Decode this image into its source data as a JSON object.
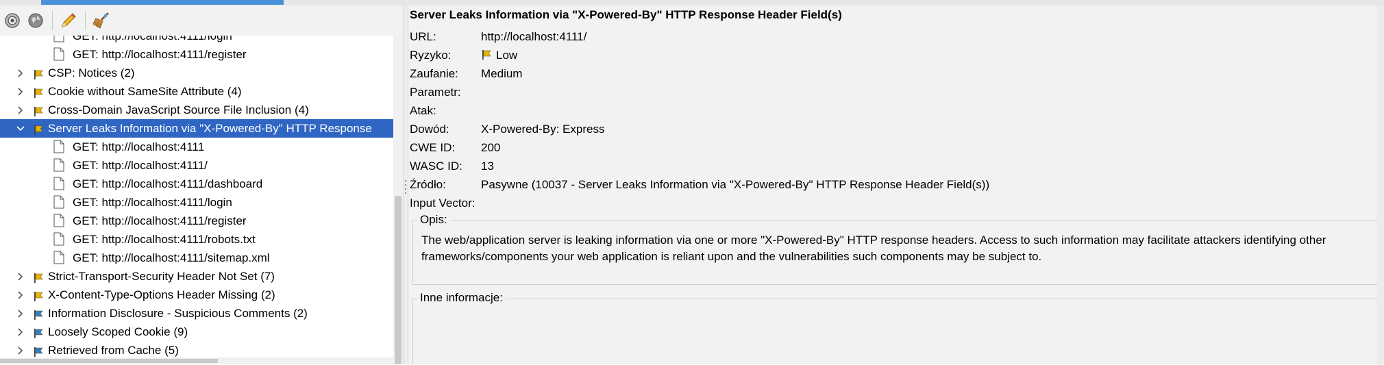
{
  "toolbar": {
    "buttons": [
      {
        "icon": "target-icon"
      },
      {
        "icon": "globe-icon"
      },
      {
        "icon": "pencil-icon"
      },
      {
        "icon": "broom-icon"
      }
    ]
  },
  "tree": {
    "rows": [
      {
        "kind": "url",
        "label": "GET: http://localhost:4111/login"
      },
      {
        "kind": "url",
        "label": "GET: http://localhost:4111/register"
      },
      {
        "kind": "alert",
        "risk": "low",
        "expanded": false,
        "label": "CSP: Notices (2)"
      },
      {
        "kind": "alert",
        "risk": "low",
        "expanded": false,
        "label": "Cookie without SameSite Attribute (4)"
      },
      {
        "kind": "alert",
        "risk": "low",
        "expanded": false,
        "label": "Cross-Domain JavaScript Source File Inclusion (4)"
      },
      {
        "kind": "alert",
        "risk": "low",
        "expanded": true,
        "selected": true,
        "label": "Server Leaks Information via \"X-Powered-By\" HTTP Response"
      },
      {
        "kind": "url",
        "label": "GET: http://localhost:4111"
      },
      {
        "kind": "url",
        "label": "GET: http://localhost:4111/"
      },
      {
        "kind": "url",
        "label": "GET: http://localhost:4111/dashboard"
      },
      {
        "kind": "url",
        "label": "GET: http://localhost:4111/login"
      },
      {
        "kind": "url",
        "label": "GET: http://localhost:4111/register"
      },
      {
        "kind": "url",
        "label": "GET: http://localhost:4111/robots.txt"
      },
      {
        "kind": "url",
        "label": "GET: http://localhost:4111/sitemap.xml"
      },
      {
        "kind": "alert",
        "risk": "low",
        "expanded": false,
        "label": "Strict-Transport-Security Header Not Set (7)"
      },
      {
        "kind": "alert",
        "risk": "low",
        "expanded": false,
        "label": "X-Content-Type-Options Header Missing (2)"
      },
      {
        "kind": "alert",
        "risk": "info",
        "expanded": false,
        "label": "Information Disclosure - Suspicious Comments (2)"
      },
      {
        "kind": "alert",
        "risk": "info",
        "expanded": false,
        "label": "Loosely Scoped Cookie (9)"
      },
      {
        "kind": "alert",
        "risk": "info",
        "expanded": false,
        "label": "Retrieved from Cache (5)"
      }
    ]
  },
  "details": {
    "title": "Server Leaks Information via \"X-Powered-By\" HTTP Response Header Field(s)",
    "fields": [
      {
        "key": "URL:",
        "value": "http://localhost:4111/"
      },
      {
        "key": "Ryzyko:",
        "value": "Low",
        "flag": true
      },
      {
        "key": "Zaufanie:",
        "value": "Medium"
      },
      {
        "key": "Parametr:",
        "value": ""
      },
      {
        "key": "Atak:",
        "value": ""
      },
      {
        "key": "Dowód:",
        "value": "X-Powered-By: Express"
      },
      {
        "key": "CWE ID:",
        "value": "200"
      },
      {
        "key": "WASC ID:",
        "value": "13"
      },
      {
        "key": "Źródło:",
        "value": "Pasywne (10037 - Server Leaks Information via \"X-Powered-By\" HTTP Response Header Field(s))"
      },
      {
        "key": "Input Vector:",
        "value": ""
      }
    ],
    "description": {
      "title": "Opis:",
      "text": "The web/application server is leaking information via one or more \"X-Powered-By\" HTTP response headers. Access to such information may facilitate attackers identifying other frameworks/components your web application is reliant upon and the vulnerabilities such components may be subject to."
    },
    "other_info": {
      "title": "Inne informacje:",
      "text": ""
    }
  },
  "colors": {
    "selection": "#2f66c3",
    "flag_low": "#e8b400",
    "flag_info": "#2f7fd4"
  }
}
